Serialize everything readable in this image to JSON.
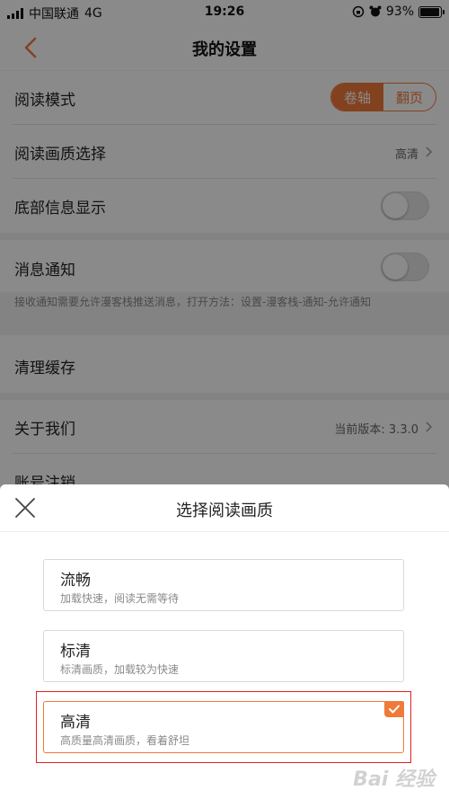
{
  "status_bar": {
    "carrier": "中国联通",
    "network": "4G",
    "time": "19:26",
    "battery": "93%",
    "battery_level": 0.93
  },
  "nav": {
    "title": "我的设置"
  },
  "settings": {
    "reading_mode": {
      "label": "阅读模式",
      "options": [
        "卷轴",
        "翻页"
      ],
      "selected": "卷轴"
    },
    "quality": {
      "label": "阅读画质选择",
      "value": "高清"
    },
    "bottom_info": {
      "label": "底部信息显示",
      "on": false
    },
    "notifications": {
      "label": "消息通知",
      "on": false,
      "hint": "接收通知需要允许漫客栈推送消息，打开方法：设置-漫客栈-通知-允许通知"
    },
    "clear_cache": {
      "label": "清理缓存"
    },
    "about": {
      "label": "关于我们",
      "value": "当前版本: 3.3.0"
    },
    "account": {
      "label": "账号注销"
    }
  },
  "sheet": {
    "title": "选择阅读画质",
    "options": [
      {
        "title": "流畅",
        "desc": "加载快速，阅读无需等待"
      },
      {
        "title": "标清",
        "desc": "标清画质，加载较为快速"
      },
      {
        "title": "高清",
        "desc": "高质量高清画质，看着舒坦"
      }
    ],
    "selected_index": 2
  },
  "watermark": "Bai 经验",
  "colors": {
    "accent": "#f07a3a",
    "highlight_frame": "#e02020"
  }
}
